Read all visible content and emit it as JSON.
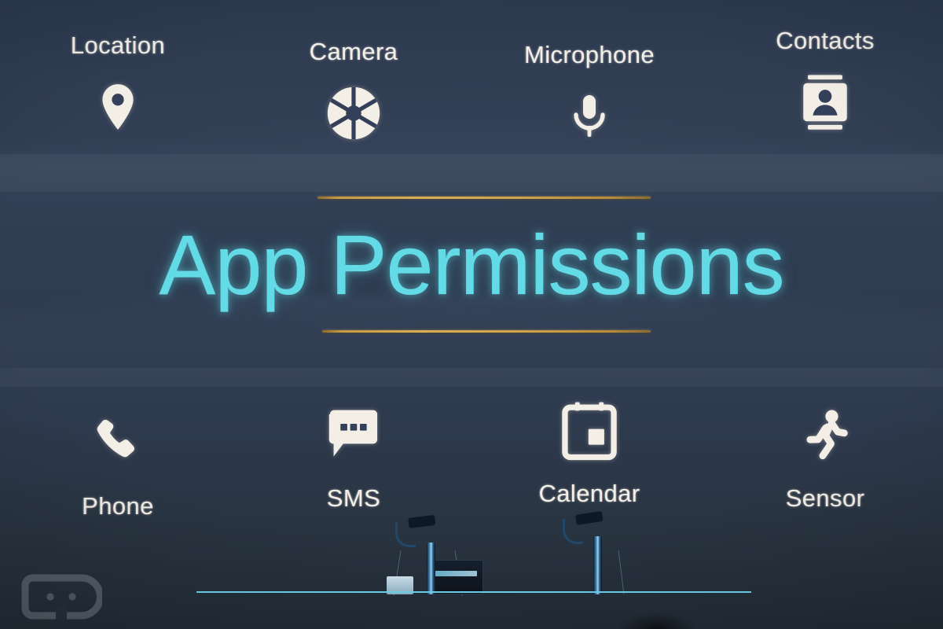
{
  "slide": {
    "title": "App Permissions",
    "title_color": "#63dbe6",
    "background_color": "#313e54",
    "rule_color": "#d8ae55",
    "label_color": "#f2efe9"
  },
  "permissions_top": [
    {
      "label": "Location",
      "icon": "location-pin-icon"
    },
    {
      "label": "Camera",
      "icon": "camera-aperture-icon"
    },
    {
      "label": "Microphone",
      "icon": "microphone-icon"
    },
    {
      "label": "Contacts",
      "icon": "contact-card-icon"
    }
  ],
  "permissions_bottom": [
    {
      "label": "Phone",
      "icon": "phone-handset-icon"
    },
    {
      "label": "SMS",
      "icon": "sms-bubble-icon"
    },
    {
      "label": "Calendar",
      "icon": "calendar-icon"
    },
    {
      "label": "Sensor",
      "icon": "running-person-icon"
    }
  ],
  "stage": {
    "podium_color": "#1486ad",
    "watermark": "droid-life-logo"
  }
}
